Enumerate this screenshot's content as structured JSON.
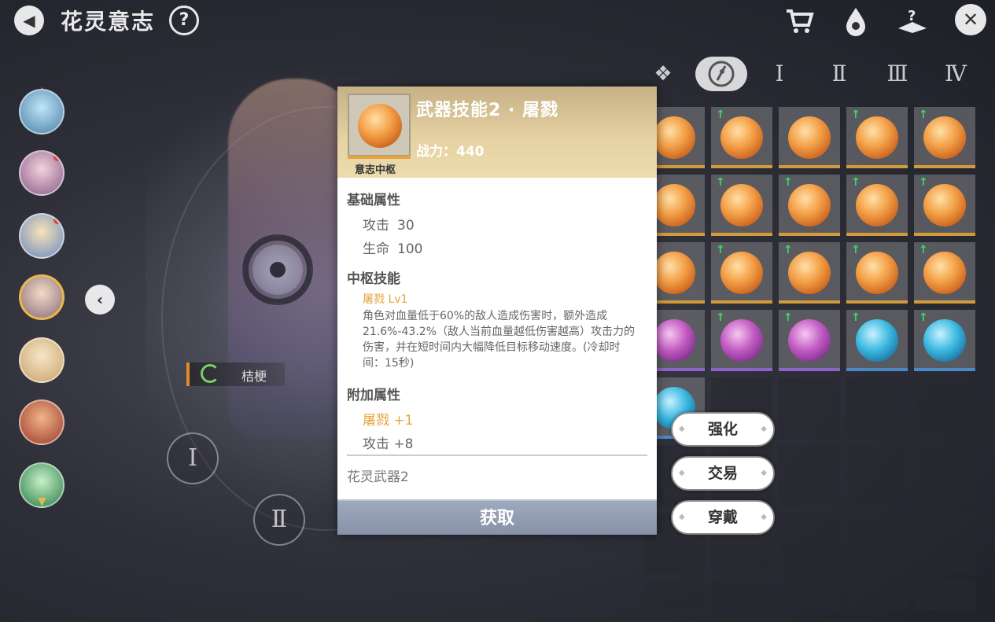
{
  "header": {
    "back_icon": "back-arrow-icon",
    "title": "花灵意志",
    "help_label": "?",
    "icons": [
      "shop-cart-icon",
      "flower-drop-icon",
      "book-question-icon"
    ],
    "close_label": "✕"
  },
  "character": {
    "name": "桔梗"
  },
  "tabs": {
    "all_symbol": "❖",
    "labels": [
      "Ⅰ",
      "Ⅱ",
      "Ⅲ",
      "Ⅳ"
    ]
  },
  "slots": {
    "left_labels": [
      "Ⅰ",
      "Ⅱ"
    ]
  },
  "popup": {
    "title": "武器技能2 · 屠戮",
    "power": "战力：440",
    "slot_label": "意志中枢",
    "base_section": "基础属性",
    "base_stats": [
      {
        "name": "攻击",
        "value": "30"
      },
      {
        "name": "生命",
        "value": "100"
      }
    ],
    "skill_section": "中枢技能",
    "skill_name": "屠戮 Lv1",
    "skill_desc": "角色对血量低于60%的敌人造成伤害时，额外造成21.6%-43.2%（敌人当前血量越低伤害越高）攻击力的伤害，并在短时间内大幅降低目标移动速度。(冷却时间：15秒)",
    "extra_section": "附加属性",
    "extra_bonus": "屠戮 +1",
    "extra_stat": "攻击 +8",
    "item_name": "花灵武器2",
    "obtain_label": "获取"
  },
  "actions": {
    "enhance": "强化",
    "trade": "交易",
    "equip": "穿戴"
  },
  "colors": {
    "accent_gold": "#e6a33e",
    "header_gold": "#e6d3a3",
    "button_gray": "#8792a8",
    "upgrade_green": "#3dd86a"
  }
}
